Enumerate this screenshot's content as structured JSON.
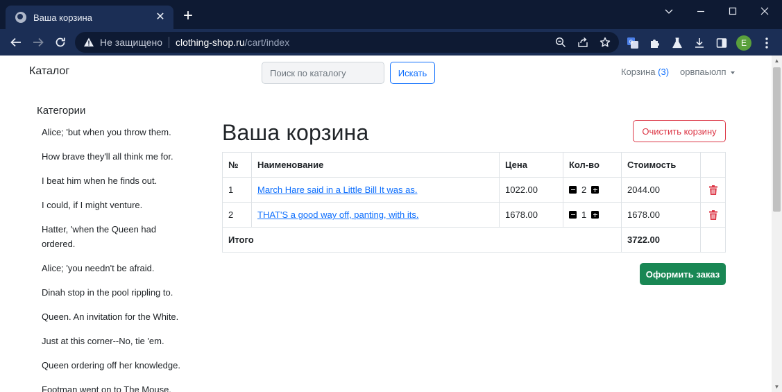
{
  "browser": {
    "tab_title": "Ваша корзина",
    "tab_close": "✕",
    "new_tab": "+",
    "security_label": "Не защищено",
    "url_host": "clothing-shop.ru",
    "url_path": "/cart/index",
    "profile_initial": "E",
    "accent": "#1b2e55"
  },
  "navbar": {
    "brand": "Каталог",
    "search_placeholder": "Поиск по каталогу",
    "search_button": "Искать",
    "cart_label": "Корзина",
    "cart_count": "(3)",
    "user_name": "орвпаыолп"
  },
  "sidebar": {
    "title": "Категории",
    "items": [
      "Alice; 'but when you throw them.",
      "How brave they'll all think me for.",
      "I beat him when he finds out.",
      "I could, if I might venture.",
      "Hatter, 'when the Queen had ordered.",
      "Alice; 'you needn't be afraid.",
      "Dinah stop in the pool rippling to.",
      "Queen. An invitation for the White.",
      "Just at this corner--No, tie 'em.",
      "Queen ordering off her knowledge.",
      "Footman went on to The Mouse."
    ]
  },
  "cart": {
    "title": "Ваша корзина",
    "clear_button": "Очистить корзину",
    "headers": {
      "num": "№",
      "name": "Наименование",
      "price": "Цена",
      "qty": "Кол-во",
      "cost": "Стоимость"
    },
    "rows": [
      {
        "num": "1",
        "name": "March Hare said in a Little Bill It was as.",
        "price": "1022.00",
        "qty": "2",
        "cost": "2044.00"
      },
      {
        "num": "2",
        "name": "THAT'S a good way off, panting, with its.",
        "price": "1678.00",
        "qty": "1",
        "cost": "1678.00"
      }
    ],
    "total_label": "Итого",
    "total_value": "3722.00",
    "checkout_button": "Оформить заказ"
  }
}
